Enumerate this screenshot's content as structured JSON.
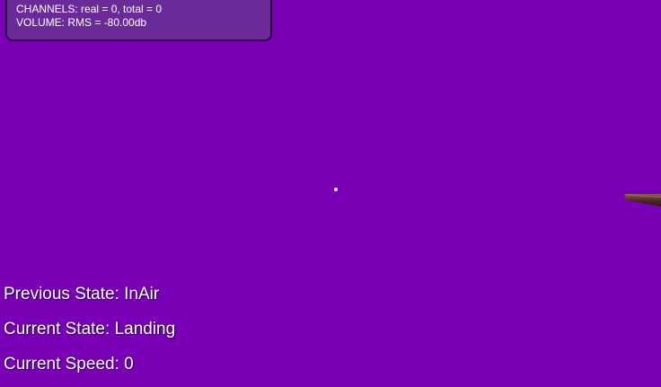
{
  "debug": {
    "channels": "CHANNELS: real = 0, total = 0",
    "volume": "VOLUME: RMS = -80.00db"
  },
  "hud": {
    "previous_state_label": "Previous State:",
    "previous_state_value": "InAir",
    "current_state_label": "Current State:",
    "current_state_value": "Landing",
    "current_speed_label": "Current Speed:",
    "current_speed_value": "0"
  },
  "colors": {
    "background": "#7a00b8",
    "panel": "#6a2a98",
    "text": "#ffffff"
  }
}
